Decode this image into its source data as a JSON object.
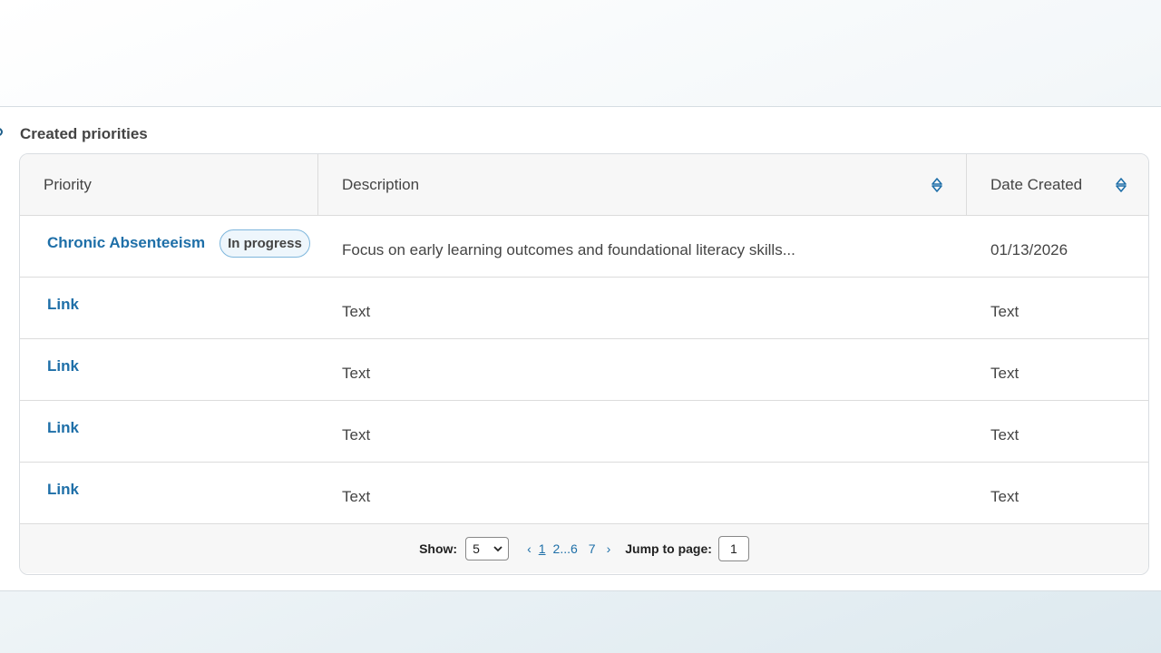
{
  "section": {
    "title": "Created priorities"
  },
  "table": {
    "columns": [
      {
        "label": "Priority",
        "sortable": false
      },
      {
        "label": "Description",
        "sortable": true
      },
      {
        "label": "Date Created",
        "sortable": true
      }
    ],
    "rows": [
      {
        "priority": "Chronic Absenteeism",
        "badge": "In progress",
        "description": "Focus on early learning outcomes and foundational literacy skills...",
        "date": "01/13/2026"
      },
      {
        "priority": "Link",
        "description": "Text",
        "date": "Text"
      },
      {
        "priority": "Link",
        "description": "Text",
        "date": "Text"
      },
      {
        "priority": "Link",
        "description": "Text",
        "date": "Text"
      },
      {
        "priority": "Link",
        "description": "Text",
        "date": "Text"
      }
    ]
  },
  "pagination": {
    "show_label": "Show:",
    "show_value": "5",
    "prev": "‹",
    "pages": [
      "1",
      "2",
      "...",
      "6",
      "7"
    ],
    "current_page": "1",
    "next": "›",
    "jump_label": "Jump to page:",
    "jump_value": "1"
  },
  "colors": {
    "link": "#1e6fa8",
    "badge_border": "#7eb6dc",
    "header_bg": "#f7f7f7"
  }
}
